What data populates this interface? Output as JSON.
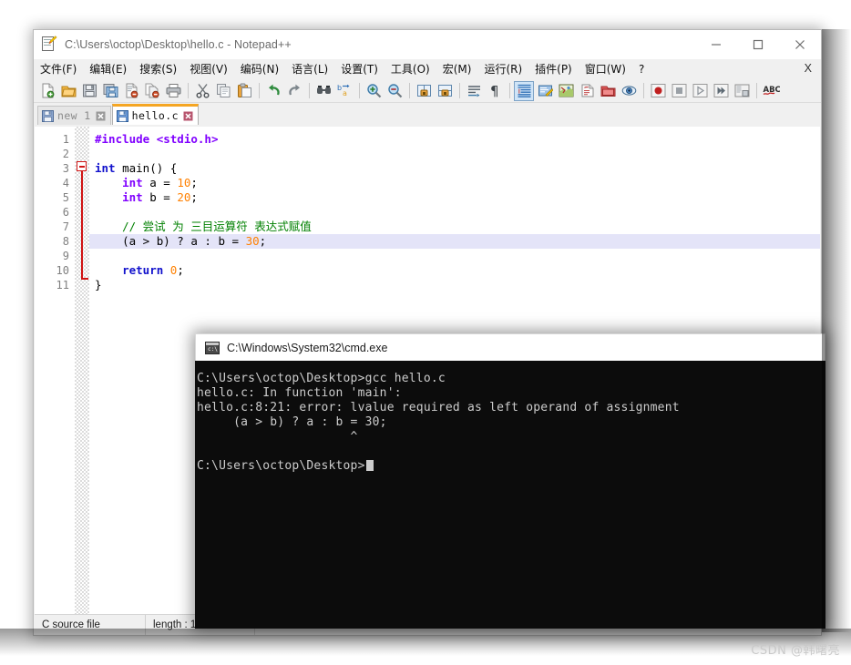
{
  "editor_window": {
    "title": "C:\\Users\\octop\\Desktop\\hello.c - Notepad++",
    "app_icon": "notepad-plus-plus-icon",
    "window_controls": {
      "minimize": "minimize-icon",
      "maximize": "maximize-icon",
      "close": "close-icon"
    },
    "menubar": {
      "items": [
        "文件(F)",
        "编辑(E)",
        "搜索(S)",
        "视图(V)",
        "编码(N)",
        "语言(L)",
        "设置(T)",
        "工具(O)",
        "宏(M)",
        "运行(R)",
        "插件(P)",
        "窗口(W)",
        "?"
      ],
      "close_document_label": "X"
    },
    "toolbar": {
      "groups": [
        [
          {
            "name": "new-file-icon",
            "tip": "新建"
          },
          {
            "name": "open-file-icon",
            "tip": "打开"
          },
          {
            "name": "save-icon",
            "tip": "保存"
          },
          {
            "name": "save-all-icon",
            "tip": "全部保存"
          },
          {
            "name": "close-file-icon",
            "tip": "关闭"
          },
          {
            "name": "close-all-files-icon",
            "tip": "全部关闭"
          },
          {
            "name": "print-icon",
            "tip": "打印"
          }
        ],
        [
          {
            "name": "cut-icon",
            "tip": "剪切"
          },
          {
            "name": "copy-icon",
            "tip": "复制"
          },
          {
            "name": "paste-icon",
            "tip": "粘贴"
          }
        ],
        [
          {
            "name": "undo-icon",
            "tip": "撤销"
          },
          {
            "name": "redo-icon",
            "tip": "重做"
          }
        ],
        [
          {
            "name": "find-icon",
            "tip": "查找"
          },
          {
            "name": "replace-icon",
            "tip": "替换"
          }
        ],
        [
          {
            "name": "zoom-in-icon",
            "tip": "放大"
          },
          {
            "name": "zoom-out-icon",
            "tip": "缩小"
          }
        ],
        [
          {
            "name": "sync-vertical-scroll-icon",
            "tip": "同步垂直滚动"
          },
          {
            "name": "sync-horizontal-scroll-icon",
            "tip": "同步水平滚动"
          }
        ],
        [
          {
            "name": "word-wrap-icon",
            "tip": "自动换行"
          },
          {
            "name": "show-all-characters-icon",
            "tip": "显示所有符号"
          }
        ],
        [
          {
            "name": "indent-guide-icon",
            "tip": "缩进参考线",
            "active": true
          },
          {
            "name": "user-defined-language-icon",
            "tip": "用户自定义语言"
          },
          {
            "name": "document-map-icon",
            "tip": "文档地图"
          },
          {
            "name": "function-list-icon",
            "tip": "函数列表"
          },
          {
            "name": "folder-as-workspace-icon",
            "tip": "文件夹作为工作区"
          },
          {
            "name": "monitor-icon",
            "tip": "监视文件"
          }
        ],
        [
          {
            "name": "record-macro-icon",
            "tip": "开始录制"
          },
          {
            "name": "stop-macro-icon",
            "tip": "停止录制"
          },
          {
            "name": "play-macro-icon",
            "tip": "播放"
          },
          {
            "name": "run-macro-multiple-icon",
            "tip": "多次运行宏"
          },
          {
            "name": "save-macro-icon",
            "tip": "保存当前录制的宏"
          }
        ],
        [
          {
            "name": "spell-check-icon",
            "tip": "拼写检查"
          }
        ]
      ]
    },
    "tabs": [
      {
        "label": "new 1",
        "active": false,
        "icon": "save-blue-icon",
        "close": "close-icon"
      },
      {
        "label": "hello.c",
        "active": true,
        "icon": "save-blue-icon",
        "close": "close-icon"
      }
    ],
    "code": {
      "line_numbers": [
        "1",
        "2",
        "3",
        "4",
        "5",
        "6",
        "7",
        "8",
        "9",
        "10",
        "11"
      ],
      "highlighted_line": 8,
      "fold_marker_line": 3,
      "lines": [
        [
          {
            "t": "#include ",
            "c": "k-pre"
          },
          {
            "t": "<stdio.h>",
            "c": "k-pre"
          }
        ],
        [],
        [
          {
            "t": "int",
            "c": "k-kw"
          },
          {
            "t": " ",
            "c": "k-ident"
          },
          {
            "t": "main",
            "c": "k-ident"
          },
          {
            "t": "() {",
            "c": "k-ident"
          }
        ],
        [
          {
            "t": "    ",
            "c": "k-ident"
          },
          {
            "t": "int",
            "c": "k-type"
          },
          {
            "t": " a = ",
            "c": "k-ident"
          },
          {
            "t": "10",
            "c": "k-num"
          },
          {
            "t": ";",
            "c": "k-ident"
          }
        ],
        [
          {
            "t": "    ",
            "c": "k-ident"
          },
          {
            "t": "int",
            "c": "k-type"
          },
          {
            "t": " b = ",
            "c": "k-ident"
          },
          {
            "t": "20",
            "c": "k-num"
          },
          {
            "t": ";",
            "c": "k-ident"
          }
        ],
        [],
        [
          {
            "t": "    ",
            "c": "k-ident"
          },
          {
            "t": "// 尝试 为 三目运算符 表达式赋值",
            "c": "k-com"
          }
        ],
        [
          {
            "t": "    (a > b) ? a : b = ",
            "c": "k-ident"
          },
          {
            "t": "30",
            "c": "k-num"
          },
          {
            "t": ";",
            "c": "k-ident"
          }
        ],
        [],
        [
          {
            "t": "    ",
            "c": "k-ident"
          },
          {
            "t": "return",
            "c": "k-kw"
          },
          {
            "t": " ",
            "c": "k-ident"
          },
          {
            "t": "0",
            "c": "k-num"
          },
          {
            "t": ";",
            "c": "k-ident"
          }
        ],
        [
          {
            "t": "}",
            "c": "k-ident"
          }
        ]
      ],
      "plain_text": "#include <stdio.h>\n\nint main() {\n    int a = 10;\n    int b = 20;\n\n    // 尝试 为 三目运算符 表达式赋值\n    (a > b) ? a : b = 30;\n\n    return 0;\n}"
    },
    "statusbar": {
      "doc_type": "C source file",
      "length_label": "length : 1"
    }
  },
  "terminal_window": {
    "title": "C:\\Windows\\System32\\cmd.exe",
    "icon": "cmd-console-icon",
    "lines": [
      "C:\\Users\\octop\\Desktop>gcc hello.c",
      "hello.c: In function 'main':",
      "hello.c:8:21: error: lvalue required as left operand of assignment",
      "     (a > b) ? a : b = 30;",
      "                     ^",
      "",
      "C:\\Users\\octop\\Desktop>"
    ],
    "prompt_last": "C:\\Users\\octop\\Desktop>",
    "cursor": "block-cursor"
  },
  "watermark": {
    "text": "CSDN @韩曙亮"
  },
  "colors": {
    "accent_tab_active": "#f5a623",
    "fold_marker": "#d01414",
    "highlight_line": "#e4e4f8",
    "terminal_bg": "#0c0c0c",
    "terminal_fg": "#cccccc",
    "keyword": "#1111cc",
    "type": "#8000ff",
    "number": "#ff8000",
    "comment": "#008000",
    "preprocessor": "#8000ff"
  }
}
